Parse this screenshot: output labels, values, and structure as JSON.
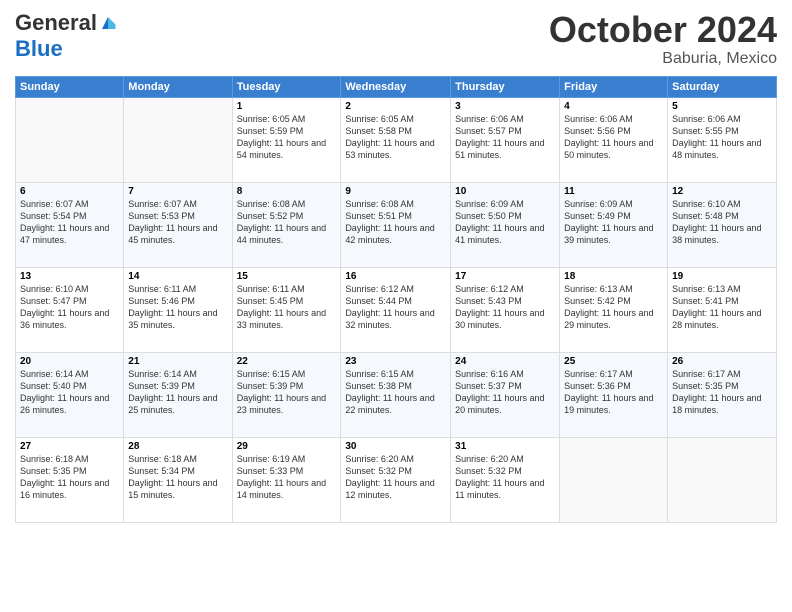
{
  "header": {
    "logo": {
      "general": "General",
      "blue": "Blue",
      "tagline": ""
    },
    "title": "October 2024",
    "location": "Baburia, Mexico"
  },
  "weekdays": [
    "Sunday",
    "Monday",
    "Tuesday",
    "Wednesday",
    "Thursday",
    "Friday",
    "Saturday"
  ],
  "weeks": [
    [
      {
        "day": "",
        "info": ""
      },
      {
        "day": "",
        "info": ""
      },
      {
        "day": "1",
        "sunrise": "6:05 AM",
        "sunset": "5:59 PM",
        "daylight": "11 hours and 54 minutes."
      },
      {
        "day": "2",
        "sunrise": "6:05 AM",
        "sunset": "5:58 PM",
        "daylight": "11 hours and 53 minutes."
      },
      {
        "day": "3",
        "sunrise": "6:06 AM",
        "sunset": "5:57 PM",
        "daylight": "11 hours and 51 minutes."
      },
      {
        "day": "4",
        "sunrise": "6:06 AM",
        "sunset": "5:56 PM",
        "daylight": "11 hours and 50 minutes."
      },
      {
        "day": "5",
        "sunrise": "6:06 AM",
        "sunset": "5:55 PM",
        "daylight": "11 hours and 48 minutes."
      }
    ],
    [
      {
        "day": "6",
        "sunrise": "6:07 AM",
        "sunset": "5:54 PM",
        "daylight": "11 hours and 47 minutes."
      },
      {
        "day": "7",
        "sunrise": "6:07 AM",
        "sunset": "5:53 PM",
        "daylight": "11 hours and 45 minutes."
      },
      {
        "day": "8",
        "sunrise": "6:08 AM",
        "sunset": "5:52 PM",
        "daylight": "11 hours and 44 minutes."
      },
      {
        "day": "9",
        "sunrise": "6:08 AM",
        "sunset": "5:51 PM",
        "daylight": "11 hours and 42 minutes."
      },
      {
        "day": "10",
        "sunrise": "6:09 AM",
        "sunset": "5:50 PM",
        "daylight": "11 hours and 41 minutes."
      },
      {
        "day": "11",
        "sunrise": "6:09 AM",
        "sunset": "5:49 PM",
        "daylight": "11 hours and 39 minutes."
      },
      {
        "day": "12",
        "sunrise": "6:10 AM",
        "sunset": "5:48 PM",
        "daylight": "11 hours and 38 minutes."
      }
    ],
    [
      {
        "day": "13",
        "sunrise": "6:10 AM",
        "sunset": "5:47 PM",
        "daylight": "11 hours and 36 minutes."
      },
      {
        "day": "14",
        "sunrise": "6:11 AM",
        "sunset": "5:46 PM",
        "daylight": "11 hours and 35 minutes."
      },
      {
        "day": "15",
        "sunrise": "6:11 AM",
        "sunset": "5:45 PM",
        "daylight": "11 hours and 33 minutes."
      },
      {
        "day": "16",
        "sunrise": "6:12 AM",
        "sunset": "5:44 PM",
        "daylight": "11 hours and 32 minutes."
      },
      {
        "day": "17",
        "sunrise": "6:12 AM",
        "sunset": "5:43 PM",
        "daylight": "11 hours and 30 minutes."
      },
      {
        "day": "18",
        "sunrise": "6:13 AM",
        "sunset": "5:42 PM",
        "daylight": "11 hours and 29 minutes."
      },
      {
        "day": "19",
        "sunrise": "6:13 AM",
        "sunset": "5:41 PM",
        "daylight": "11 hours and 28 minutes."
      }
    ],
    [
      {
        "day": "20",
        "sunrise": "6:14 AM",
        "sunset": "5:40 PM",
        "daylight": "11 hours and 26 minutes."
      },
      {
        "day": "21",
        "sunrise": "6:14 AM",
        "sunset": "5:39 PM",
        "daylight": "11 hours and 25 minutes."
      },
      {
        "day": "22",
        "sunrise": "6:15 AM",
        "sunset": "5:39 PM",
        "daylight": "11 hours and 23 minutes."
      },
      {
        "day": "23",
        "sunrise": "6:15 AM",
        "sunset": "5:38 PM",
        "daylight": "11 hours and 22 minutes."
      },
      {
        "day": "24",
        "sunrise": "6:16 AM",
        "sunset": "5:37 PM",
        "daylight": "11 hours and 20 minutes."
      },
      {
        "day": "25",
        "sunrise": "6:17 AM",
        "sunset": "5:36 PM",
        "daylight": "11 hours and 19 minutes."
      },
      {
        "day": "26",
        "sunrise": "6:17 AM",
        "sunset": "5:35 PM",
        "daylight": "11 hours and 18 minutes."
      }
    ],
    [
      {
        "day": "27",
        "sunrise": "6:18 AM",
        "sunset": "5:35 PM",
        "daylight": "11 hours and 16 minutes."
      },
      {
        "day": "28",
        "sunrise": "6:18 AM",
        "sunset": "5:34 PM",
        "daylight": "11 hours and 15 minutes."
      },
      {
        "day": "29",
        "sunrise": "6:19 AM",
        "sunset": "5:33 PM",
        "daylight": "11 hours and 14 minutes."
      },
      {
        "day": "30",
        "sunrise": "6:20 AM",
        "sunset": "5:32 PM",
        "daylight": "11 hours and 12 minutes."
      },
      {
        "day": "31",
        "sunrise": "6:20 AM",
        "sunset": "5:32 PM",
        "daylight": "11 hours and 11 minutes."
      },
      {
        "day": "",
        "info": ""
      },
      {
        "day": "",
        "info": ""
      }
    ]
  ]
}
